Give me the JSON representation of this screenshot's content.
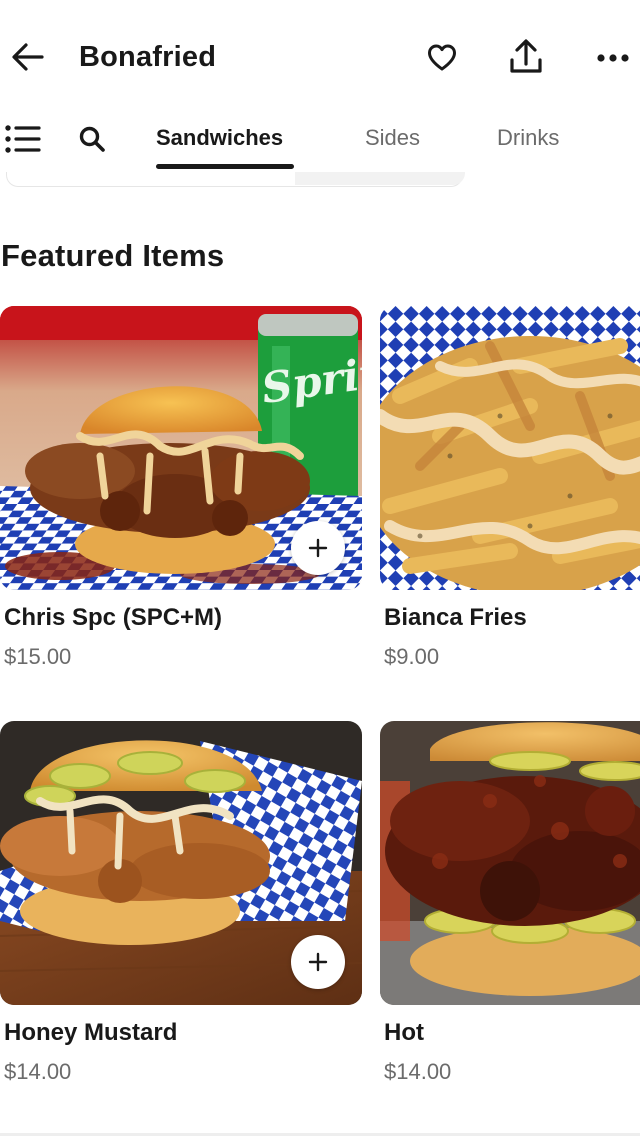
{
  "header": {
    "title": "Bonafried",
    "icons": {
      "back": "arrow-left-icon",
      "favorite": "heart-icon",
      "share": "share-icon",
      "more": "more-horizontal-icon"
    }
  },
  "tabs": {
    "icons": {
      "menu": "list-icon",
      "search": "search-icon"
    },
    "items": [
      {
        "label": "Sandwiches",
        "active": true
      },
      {
        "label": "Sides",
        "active": false
      },
      {
        "label": "Drinks",
        "active": false
      }
    ]
  },
  "featured": {
    "title": "Featured Items",
    "items": [
      {
        "name": "Chris Spc (SPC+M)",
        "price": "$15.00",
        "add_icon": "plus-icon"
      },
      {
        "name": "Bianca Fries",
        "price": "$9.00"
      },
      {
        "name": "Honey Mustard",
        "price": "$14.00",
        "add_icon": "plus-icon"
      },
      {
        "name": "Hot",
        "price": "$14.00"
      }
    ],
    "can_label": "Sprite"
  },
  "colors": {
    "text_primary": "#191919",
    "text_secondary": "#6b6b6b",
    "background": "#ffffff"
  }
}
